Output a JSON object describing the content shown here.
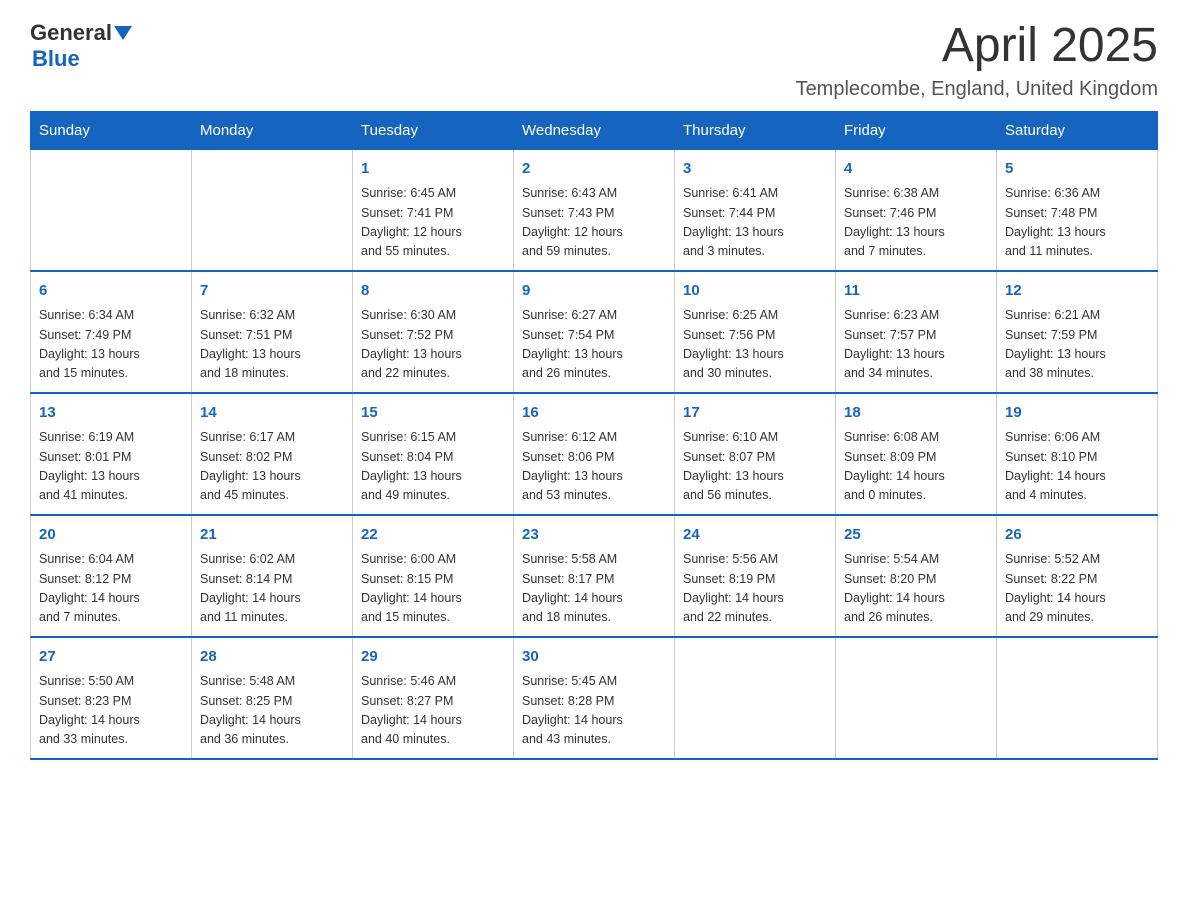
{
  "header": {
    "logo_general": "General",
    "logo_blue": "Blue",
    "month_title": "April 2025",
    "location": "Templecombe, England, United Kingdom"
  },
  "weekdays": [
    "Sunday",
    "Monday",
    "Tuesday",
    "Wednesday",
    "Thursday",
    "Friday",
    "Saturday"
  ],
  "weeks": [
    [
      {
        "day": "",
        "info": ""
      },
      {
        "day": "",
        "info": ""
      },
      {
        "day": "1",
        "info": "Sunrise: 6:45 AM\nSunset: 7:41 PM\nDaylight: 12 hours\nand 55 minutes."
      },
      {
        "day": "2",
        "info": "Sunrise: 6:43 AM\nSunset: 7:43 PM\nDaylight: 12 hours\nand 59 minutes."
      },
      {
        "day": "3",
        "info": "Sunrise: 6:41 AM\nSunset: 7:44 PM\nDaylight: 13 hours\nand 3 minutes."
      },
      {
        "day": "4",
        "info": "Sunrise: 6:38 AM\nSunset: 7:46 PM\nDaylight: 13 hours\nand 7 minutes."
      },
      {
        "day": "5",
        "info": "Sunrise: 6:36 AM\nSunset: 7:48 PM\nDaylight: 13 hours\nand 11 minutes."
      }
    ],
    [
      {
        "day": "6",
        "info": "Sunrise: 6:34 AM\nSunset: 7:49 PM\nDaylight: 13 hours\nand 15 minutes."
      },
      {
        "day": "7",
        "info": "Sunrise: 6:32 AM\nSunset: 7:51 PM\nDaylight: 13 hours\nand 18 minutes."
      },
      {
        "day": "8",
        "info": "Sunrise: 6:30 AM\nSunset: 7:52 PM\nDaylight: 13 hours\nand 22 minutes."
      },
      {
        "day": "9",
        "info": "Sunrise: 6:27 AM\nSunset: 7:54 PM\nDaylight: 13 hours\nand 26 minutes."
      },
      {
        "day": "10",
        "info": "Sunrise: 6:25 AM\nSunset: 7:56 PM\nDaylight: 13 hours\nand 30 minutes."
      },
      {
        "day": "11",
        "info": "Sunrise: 6:23 AM\nSunset: 7:57 PM\nDaylight: 13 hours\nand 34 minutes."
      },
      {
        "day": "12",
        "info": "Sunrise: 6:21 AM\nSunset: 7:59 PM\nDaylight: 13 hours\nand 38 minutes."
      }
    ],
    [
      {
        "day": "13",
        "info": "Sunrise: 6:19 AM\nSunset: 8:01 PM\nDaylight: 13 hours\nand 41 minutes."
      },
      {
        "day": "14",
        "info": "Sunrise: 6:17 AM\nSunset: 8:02 PM\nDaylight: 13 hours\nand 45 minutes."
      },
      {
        "day": "15",
        "info": "Sunrise: 6:15 AM\nSunset: 8:04 PM\nDaylight: 13 hours\nand 49 minutes."
      },
      {
        "day": "16",
        "info": "Sunrise: 6:12 AM\nSunset: 8:06 PM\nDaylight: 13 hours\nand 53 minutes."
      },
      {
        "day": "17",
        "info": "Sunrise: 6:10 AM\nSunset: 8:07 PM\nDaylight: 13 hours\nand 56 minutes."
      },
      {
        "day": "18",
        "info": "Sunrise: 6:08 AM\nSunset: 8:09 PM\nDaylight: 14 hours\nand 0 minutes."
      },
      {
        "day": "19",
        "info": "Sunrise: 6:06 AM\nSunset: 8:10 PM\nDaylight: 14 hours\nand 4 minutes."
      }
    ],
    [
      {
        "day": "20",
        "info": "Sunrise: 6:04 AM\nSunset: 8:12 PM\nDaylight: 14 hours\nand 7 minutes."
      },
      {
        "day": "21",
        "info": "Sunrise: 6:02 AM\nSunset: 8:14 PM\nDaylight: 14 hours\nand 11 minutes."
      },
      {
        "day": "22",
        "info": "Sunrise: 6:00 AM\nSunset: 8:15 PM\nDaylight: 14 hours\nand 15 minutes."
      },
      {
        "day": "23",
        "info": "Sunrise: 5:58 AM\nSunset: 8:17 PM\nDaylight: 14 hours\nand 18 minutes."
      },
      {
        "day": "24",
        "info": "Sunrise: 5:56 AM\nSunset: 8:19 PM\nDaylight: 14 hours\nand 22 minutes."
      },
      {
        "day": "25",
        "info": "Sunrise: 5:54 AM\nSunset: 8:20 PM\nDaylight: 14 hours\nand 26 minutes."
      },
      {
        "day": "26",
        "info": "Sunrise: 5:52 AM\nSunset: 8:22 PM\nDaylight: 14 hours\nand 29 minutes."
      }
    ],
    [
      {
        "day": "27",
        "info": "Sunrise: 5:50 AM\nSunset: 8:23 PM\nDaylight: 14 hours\nand 33 minutes."
      },
      {
        "day": "28",
        "info": "Sunrise: 5:48 AM\nSunset: 8:25 PM\nDaylight: 14 hours\nand 36 minutes."
      },
      {
        "day": "29",
        "info": "Sunrise: 5:46 AM\nSunset: 8:27 PM\nDaylight: 14 hours\nand 40 minutes."
      },
      {
        "day": "30",
        "info": "Sunrise: 5:45 AM\nSunset: 8:28 PM\nDaylight: 14 hours\nand 43 minutes."
      },
      {
        "day": "",
        "info": ""
      },
      {
        "day": "",
        "info": ""
      },
      {
        "day": "",
        "info": ""
      }
    ]
  ]
}
